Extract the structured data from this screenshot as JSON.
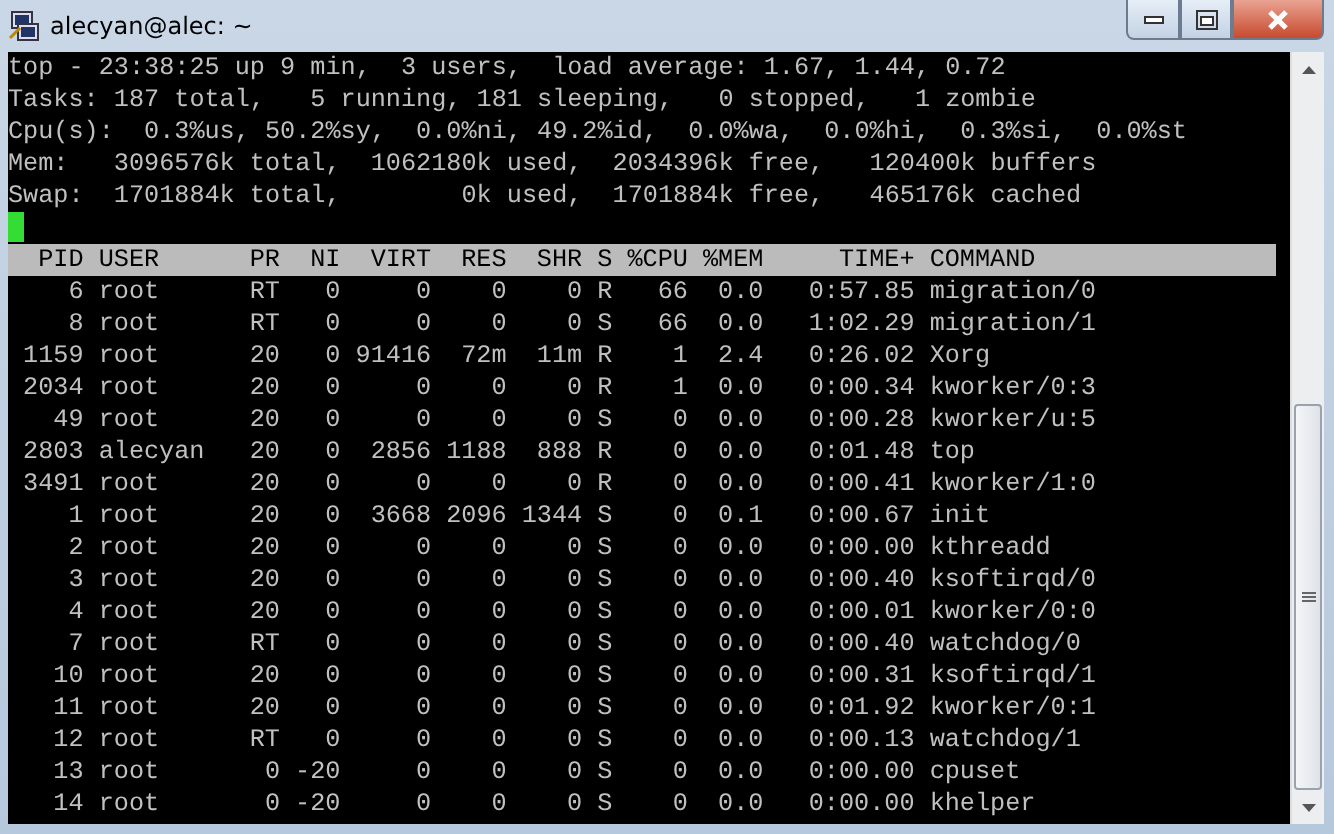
{
  "window": {
    "title": "alecyan@alec: ~"
  },
  "summary": [
    "top - 23:38:25 up 9 min,  3 users,  load average: 1.67, 1.44, 0.72",
    "Tasks: 187 total,   5 running, 181 sleeping,   0 stopped,   1 zombie",
    "Cpu(s):  0.3%us, 50.2%sy,  0.0%ni, 49.2%id,  0.0%wa,  0.0%hi,  0.3%si,  0.0%st",
    "Mem:   3096576k total,  1062180k used,  2034396k free,   120400k buffers",
    "Swap:  1701884k total,        0k used,  1701884k free,   465176k cached"
  ],
  "table": {
    "columns": [
      "PID",
      "USER",
      "PR",
      "NI",
      "VIRT",
      "RES",
      "SHR",
      "S",
      "%CPU",
      "%MEM",
      "TIME+",
      "COMMAND"
    ],
    "rows": [
      [
        "6",
        "root",
        "RT",
        "0",
        "0",
        "0",
        "0",
        "R",
        "66",
        "0.0",
        "0:57.85",
        "migration/0"
      ],
      [
        "8",
        "root",
        "RT",
        "0",
        "0",
        "0",
        "0",
        "S",
        "66",
        "0.0",
        "1:02.29",
        "migration/1"
      ],
      [
        "1159",
        "root",
        "20",
        "0",
        "91416",
        "72m",
        "11m",
        "R",
        "1",
        "2.4",
        "0:26.02",
        "Xorg"
      ],
      [
        "2034",
        "root",
        "20",
        "0",
        "0",
        "0",
        "0",
        "R",
        "1",
        "0.0",
        "0:00.34",
        "kworker/0:3"
      ],
      [
        "49",
        "root",
        "20",
        "0",
        "0",
        "0",
        "0",
        "S",
        "0",
        "0.0",
        "0:00.28",
        "kworker/u:5"
      ],
      [
        "2803",
        "alecyan",
        "20",
        "0",
        "2856",
        "1188",
        "888",
        "R",
        "0",
        "0.0",
        "0:01.48",
        "top"
      ],
      [
        "3491",
        "root",
        "20",
        "0",
        "0",
        "0",
        "0",
        "R",
        "0",
        "0.0",
        "0:00.41",
        "kworker/1:0"
      ],
      [
        "1",
        "root",
        "20",
        "0",
        "3668",
        "2096",
        "1344",
        "S",
        "0",
        "0.1",
        "0:00.67",
        "init"
      ],
      [
        "2",
        "root",
        "20",
        "0",
        "0",
        "0",
        "0",
        "S",
        "0",
        "0.0",
        "0:00.00",
        "kthreadd"
      ],
      [
        "3",
        "root",
        "20",
        "0",
        "0",
        "0",
        "0",
        "S",
        "0",
        "0.0",
        "0:00.40",
        "ksoftirqd/0"
      ],
      [
        "4",
        "root",
        "20",
        "0",
        "0",
        "0",
        "0",
        "S",
        "0",
        "0.0",
        "0:00.01",
        "kworker/0:0"
      ],
      [
        "7",
        "root",
        "RT",
        "0",
        "0",
        "0",
        "0",
        "S",
        "0",
        "0.0",
        "0:00.40",
        "watchdog/0"
      ],
      [
        "10",
        "root",
        "20",
        "0",
        "0",
        "0",
        "0",
        "S",
        "0",
        "0.0",
        "0:00.31",
        "ksoftirqd/1"
      ],
      [
        "11",
        "root",
        "20",
        "0",
        "0",
        "0",
        "0",
        "S",
        "0",
        "0.0",
        "0:01.92",
        "kworker/0:1"
      ],
      [
        "12",
        "root",
        "RT",
        "0",
        "0",
        "0",
        "0",
        "S",
        "0",
        "0.0",
        "0:00.13",
        "watchdog/1"
      ],
      [
        "13",
        "root",
        "0",
        "-20",
        "0",
        "0",
        "0",
        "S",
        "0",
        "0.0",
        "0:00.00",
        "cpuset"
      ],
      [
        "14",
        "root",
        "0",
        "-20",
        "0",
        "0",
        "0",
        "S",
        "0",
        "0.0",
        "0:00.00",
        "khelper"
      ]
    ]
  }
}
